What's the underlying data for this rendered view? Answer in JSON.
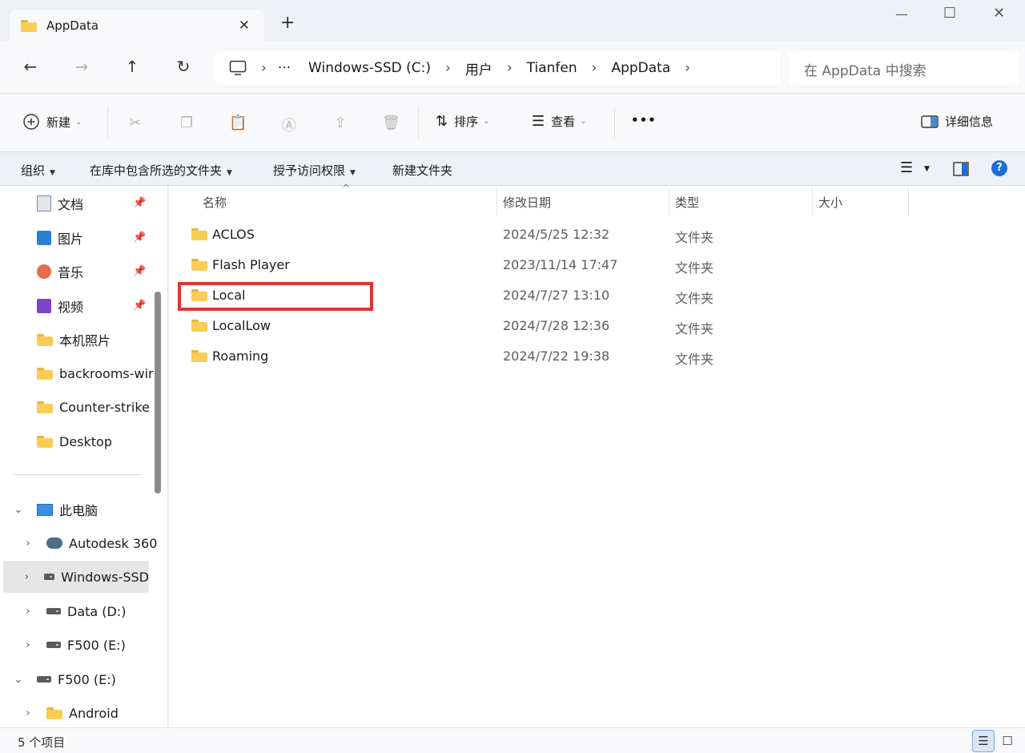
{
  "window": {
    "tab_title": "AppData",
    "close_glyph": "✕",
    "new_tab_glyph": "+",
    "minimize_glyph": "—",
    "maximize_glyph": "☐",
    "window_close_glyph": "✕"
  },
  "nav": {
    "back_glyph": "←",
    "forward_glyph": "→",
    "up_glyph": "↑",
    "refresh_glyph": "↻",
    "breadcrumbs": [
      "Windows-SSD (C:)",
      "用户",
      "Tianfen",
      "AppData"
    ],
    "more_glyph": "···",
    "chevron": "›",
    "search_placeholder": "在 AppData 中搜索"
  },
  "toolbar": {
    "new_label": "新建",
    "sort_label": "排序",
    "view_label": "查看",
    "more_label": "•••",
    "details_label": "详细信息"
  },
  "ribbon": {
    "organize": "组织",
    "include_in_library": "在库中包含所选的文件夹",
    "grant_access": "授予访问权限",
    "new_folder": "新建文件夹",
    "help_glyph": "?"
  },
  "sidebar": {
    "quick": [
      {
        "label": "文档",
        "icon": "documents-icon",
        "pinned": true
      },
      {
        "label": "图片",
        "icon": "pictures-icon",
        "pinned": true
      },
      {
        "label": "音乐",
        "icon": "music-icon",
        "pinned": true
      },
      {
        "label": "视频",
        "icon": "videos-icon",
        "pinned": true
      },
      {
        "label": "本机照片",
        "icon": "folder-icon"
      },
      {
        "label": "backrooms-wir",
        "icon": "folder-icon"
      },
      {
        "label": "Counter-strike",
        "icon": "folder-icon"
      },
      {
        "label": "Desktop",
        "icon": "folder-icon"
      }
    ],
    "this_pc": "此电脑",
    "drives": [
      {
        "label": "Autodesk 360",
        "icon": "cloud-drive-icon"
      },
      {
        "label": "Windows-SSD",
        "icon": "windows-drive-icon",
        "selected": true
      },
      {
        "label": "Data (D:)",
        "icon": "drive-icon"
      },
      {
        "label": "F500 (E:)",
        "icon": "drive-icon"
      }
    ],
    "f500": "F500 (E:)",
    "android": "Android",
    "pin_glyph": "📌",
    "expand_glyph": "›",
    "expanded_glyph": "⌄"
  },
  "columns": {
    "name": "名称",
    "modified": "修改日期",
    "type": "类型",
    "size": "大小"
  },
  "files": [
    {
      "name": "ACLOS",
      "date": "2024/5/25 12:32",
      "type": "文件夹"
    },
    {
      "name": "Flash Player",
      "date": "2023/11/14 17:47",
      "type": "文件夹"
    },
    {
      "name": "Local",
      "date": "2024/7/27 13:10",
      "type": "文件夹",
      "highlighted": true
    },
    {
      "name": "LocalLow",
      "date": "2024/7/28 12:36",
      "type": "文件夹"
    },
    {
      "name": "Roaming",
      "date": "2024/7/22 19:38",
      "type": "文件夹"
    }
  ],
  "status": {
    "item_count": "5 个项目"
  },
  "colors": {
    "highlight_border": "#e03434",
    "folder_yellow": "#f7cd57",
    "accent_blue": "#0a6ed1"
  }
}
